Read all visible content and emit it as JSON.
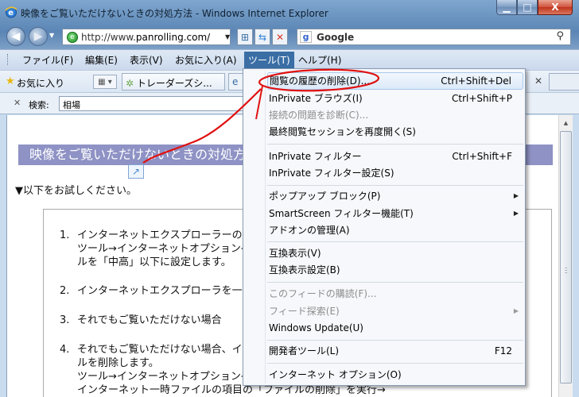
{
  "window": {
    "title": "映像をご覧いただけないときの対処方法 - Windows Internet Explorer",
    "min_glyph": "▁",
    "max_glyph": "□",
    "close_glyph": "X"
  },
  "address_bar": {
    "url_prefix": "http://www.",
    "url_domain": "panrolling.com/",
    "search_placeholder": "Google"
  },
  "menubar": {
    "items": [
      "ファイル(F)",
      "編集(E)",
      "表示(V)",
      "お気に入り(A)",
      "ツール(T)",
      "ヘルプ(H)"
    ],
    "active": "ツール(T)"
  },
  "favorites_bar": {
    "label": "お気に入り",
    "tab_title": "トレーダーズシ..."
  },
  "find_bar": {
    "label": "検索:",
    "value": "相場"
  },
  "page": {
    "heading": "映像をご覧いただけないときの対処方法",
    "intro": "▼以下をお試しください。",
    "steps": [
      {
        "num": "1.",
        "lines": [
          "インターネットエクスプローラーのセキュリティ設定を確認します。",
          "ツール→インターネットオプション→セキュリティ→レベ",
          "ルを「中高」以下に設定します。"
        ]
      },
      {
        "num": "2.",
        "lines": [
          "インターネットエクスプローラを一度閉じて、再度開きます。"
        ]
      },
      {
        "num": "3.",
        "lines": [
          "それでもご覧いただけない場合"
        ]
      },
      {
        "num": "4.",
        "lines": [
          "それでもご覧いただけない場合、インターネット一時ファイ",
          "ルを削除します。",
          "ツール→インターネットオプション→全般",
          "インターネット一時ファイルの項目の「ファイルの削除」を実行→"
        ]
      }
    ]
  },
  "tools_menu": {
    "items": [
      {
        "label": "閲覧の履歴の削除(D)...",
        "shortcut": "Ctrl+Shift+Del",
        "disabled": false,
        "submenu": false,
        "hot": true
      },
      {
        "label": "InPrivate ブラウズ(I)",
        "shortcut": "Ctrl+Shift+P",
        "disabled": false,
        "submenu": false
      },
      {
        "label": "接続の問題を診断(C)...",
        "shortcut": "",
        "disabled": true,
        "submenu": false
      },
      {
        "label": "最終閲覧セッションを再度開く(S)",
        "shortcut": "",
        "disabled": false,
        "submenu": false
      },
      {
        "label": "InPrivate フィルター",
        "shortcut": "Ctrl+Shift+F",
        "disabled": false,
        "submenu": false
      },
      {
        "label": "InPrivate フィルター設定(S)",
        "shortcut": "",
        "disabled": false,
        "submenu": false
      },
      {
        "label": "ポップアップ ブロック(P)",
        "shortcut": "",
        "disabled": false,
        "submenu": true
      },
      {
        "label": "SmartScreen フィルター機能(T)",
        "shortcut": "",
        "disabled": false,
        "submenu": true
      },
      {
        "label": "アドオンの管理(A)",
        "shortcut": "",
        "disabled": false,
        "submenu": false
      },
      {
        "label": "互換表示(V)",
        "shortcut": "",
        "disabled": false,
        "submenu": false
      },
      {
        "label": "互換表示設定(B)",
        "shortcut": "",
        "disabled": false,
        "submenu": false
      },
      {
        "label": "このフィードの購読(F)...",
        "shortcut": "",
        "disabled": true,
        "submenu": false
      },
      {
        "label": "フィード探索(E)",
        "shortcut": "",
        "disabled": true,
        "submenu": true
      },
      {
        "label": "Windows Update(U)",
        "shortcut": "",
        "disabled": false,
        "submenu": false
      },
      {
        "label": "開発者ツール(L)",
        "shortcut": "F12",
        "disabled": false,
        "submenu": false
      },
      {
        "label": "インターネット オプション(O)",
        "shortcut": "",
        "disabled": false,
        "submenu": false
      }
    ]
  },
  "colors": {
    "menu_highlight": "#3a6ea5",
    "page_heading_bg": "#8e92c4",
    "annotation_red": "#e01010"
  },
  "icons": [
    "ie-icon",
    "back-arrow-icon",
    "forward-arrow-icon",
    "globe-icon",
    "refresh-icon",
    "stop-icon",
    "google-icon",
    "search-icon",
    "favorites-star-icon",
    "quick-tabs-icon",
    "find-close-icon",
    "broken-image-icon"
  ]
}
